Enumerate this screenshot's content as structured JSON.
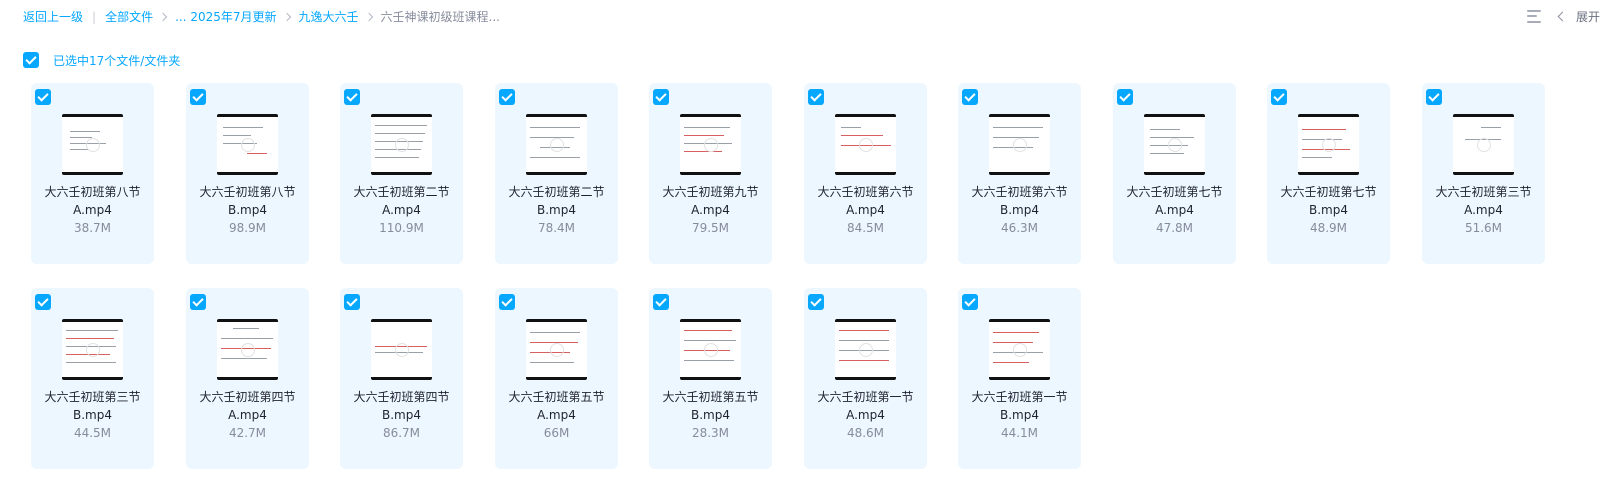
{
  "breadcrumb": {
    "back": "返回上一级",
    "all_files": "全部文件",
    "crumb_2025": "... 2025年7月更新",
    "crumb_jiuyi": "九逸大六壬",
    "current": "六壬神课初级班课程..."
  },
  "top_right": {
    "list_icon": "list-view-icon",
    "expand_label": "展开"
  },
  "selection": {
    "text": "已选中17个文件/文件夹"
  },
  "colors": {
    "accent": "#06a7ff",
    "tile_bg": "#edf7ff"
  },
  "files": [
    {
      "name1": "大六壬初班第八节",
      "name2": "A.mp4",
      "size": "38.7M"
    },
    {
      "name1": "大六壬初班第八节",
      "name2": "B.mp4",
      "size": "98.9M"
    },
    {
      "name1": "大六壬初班第二节",
      "name2": "A.mp4",
      "size": "110.9M"
    },
    {
      "name1": "大六壬初班第二节",
      "name2": "B.mp4",
      "size": "78.4M"
    },
    {
      "name1": "大六壬初班第九节",
      "name2": "A.mp4",
      "size": "79.5M"
    },
    {
      "name1": "大六壬初班第六节",
      "name2": "A.mp4",
      "size": "84.5M"
    },
    {
      "name1": "大六壬初班第六节",
      "name2": "B.mp4",
      "size": "46.3M"
    },
    {
      "name1": "大六壬初班第七节",
      "name2": "A.mp4",
      "size": "47.8M"
    },
    {
      "name1": "大六壬初班第七节",
      "name2": "B.mp4",
      "size": "48.9M"
    },
    {
      "name1": "大六壬初班第三节",
      "name2": "A.mp4",
      "size": "51.6M"
    },
    {
      "name1": "大六壬初班第三节",
      "name2": "B.mp4",
      "size": "44.5M"
    },
    {
      "name1": "大六壬初班第四节",
      "name2": "A.mp4",
      "size": "42.7M"
    },
    {
      "name1": "大六壬初班第四节",
      "name2": "B.mp4",
      "size": "86.7M"
    },
    {
      "name1": "大六壬初班第五节",
      "name2": "A.mp4",
      "size": "66M"
    },
    {
      "name1": "大六壬初班第五节",
      "name2": "B.mp4",
      "size": "28.3M"
    },
    {
      "name1": "大六壬初班第一节",
      "name2": "A.mp4",
      "size": "48.6M"
    },
    {
      "name1": "大六壬初班第一节",
      "name2": "B.mp4",
      "size": "44.1M"
    }
  ]
}
